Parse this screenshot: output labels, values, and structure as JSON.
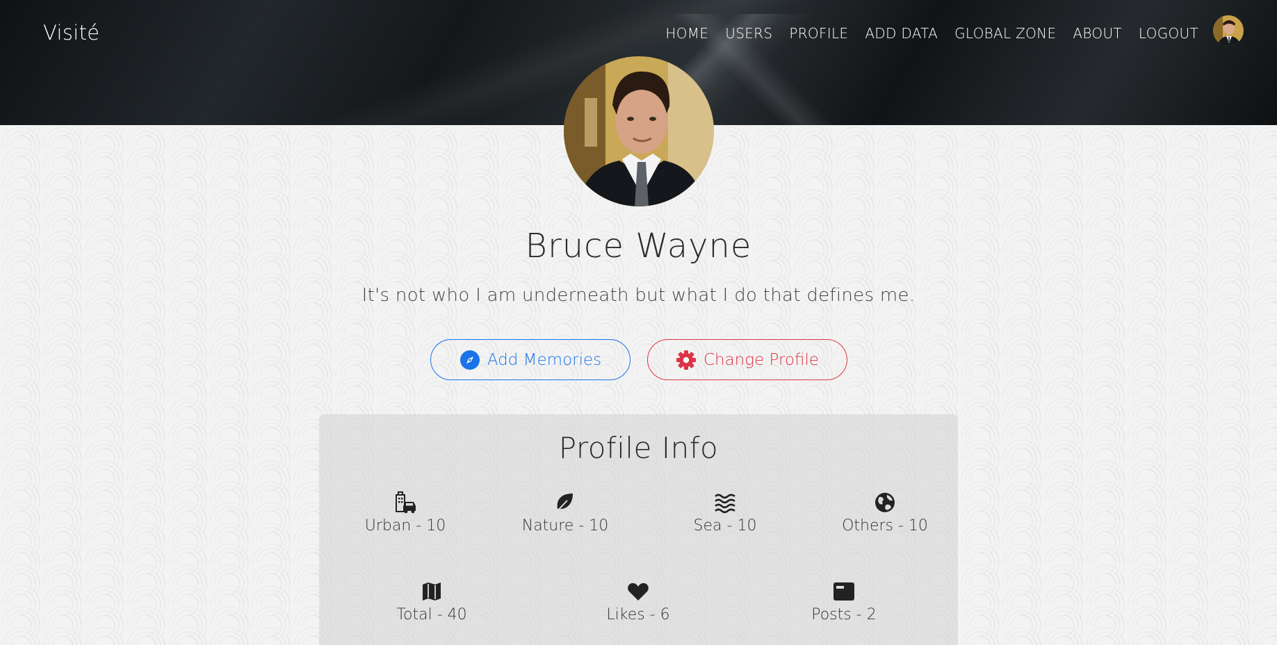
{
  "header": {
    "brand": "Visité",
    "nav": [
      "HOME",
      "USERS",
      "PROFILE",
      "ADD DATA",
      "GLOBAL ZONE",
      "ABOUT",
      "LOGOUT"
    ],
    "avatar_icon": "user-avatar"
  },
  "profile": {
    "name": "Bruce Wayne",
    "quote": "It's not who I am underneath but what I do that defines me.",
    "add_memories_label": "Add Memories",
    "change_profile_label": "Change Profile",
    "add_memories_icon": "compass-icon",
    "change_profile_icon": "gear-icon",
    "accent_blue": "#1a73e8",
    "accent_red": "#dc3545"
  },
  "info": {
    "title": "Profile Info",
    "stats": [
      {
        "label": "Urban - 10",
        "icon": "city-icon"
      },
      {
        "label": "Nature - 10",
        "icon": "leaf-icon"
      },
      {
        "label": "Sea - 10",
        "icon": "water-icon"
      },
      {
        "label": "Others - 10",
        "icon": "globe-icon"
      },
      {
        "label": "Total - 40",
        "icon": "map-icon"
      },
      {
        "label": "Likes - 6",
        "icon": "heart-icon"
      },
      {
        "label": "Posts - 2",
        "icon": "newspaper-icon"
      }
    ]
  }
}
